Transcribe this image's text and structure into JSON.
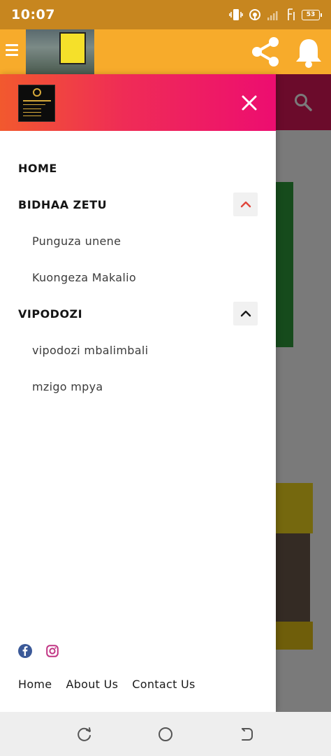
{
  "status_bar": {
    "time": "10:07",
    "battery": "53",
    "icons": [
      "vibrate-icon",
      "hotspot-icon",
      "signal-icon",
      "volte-icon",
      "battery-icon"
    ]
  },
  "app_bar": {
    "background": "#f7ab2b",
    "icons": [
      "hamburger-icon",
      "share-icon",
      "bell-icon"
    ]
  },
  "drawer": {
    "header_gradient": [
      "#f2592e",
      "#ef2c56",
      "#ed0d70"
    ],
    "accent_color": "#e0453a",
    "menu": {
      "home": "HOME",
      "bidhaa_zetu": "BIDHAA ZETU",
      "punguza_unene": "Punguza unene",
      "kuongeza_makalio": "Kuongeza Makalio",
      "vipodozi": "VIPODOZI",
      "vipodozi_mbalimbali": "vipodozi mbalimbali",
      "mzigo_mpya": "mzigo mpya"
    },
    "social": [
      "facebook-icon",
      "instagram-icon"
    ],
    "footer": {
      "home": "Home",
      "about": "About Us",
      "contact": "Contact Us"
    }
  },
  "nav_bar": {
    "icons": [
      "recents-icon",
      "home-circle-icon",
      "back-icon"
    ]
  }
}
